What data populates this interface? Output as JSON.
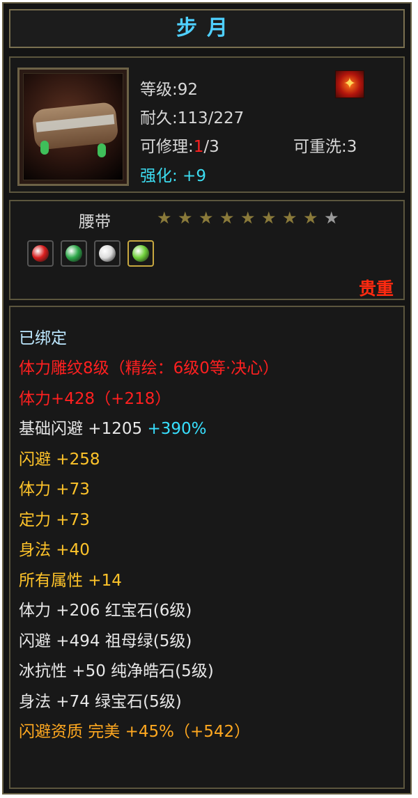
{
  "title": "步月",
  "item": {
    "level_label": "等级:92",
    "durability_label": "耐久:113/227",
    "repair_prefix": "可修理:",
    "repair_used": "1",
    "repair_total": "/3",
    "rewash_label": "可重洗:3",
    "enhance_label": "强化: +9",
    "type_label": "腰带",
    "rarity_label": "贵重",
    "stars_filled": 8,
    "stars_total": 9,
    "rune_glyph": "✦"
  },
  "gems": [
    {
      "name": "red-gem",
      "color": "#d81e1e"
    },
    {
      "name": "green-gem",
      "color": "#2ea84a"
    },
    {
      "name": "white-gem",
      "color": "#dcdcdc"
    },
    {
      "name": "emerald-gem",
      "color": "#6fcf3a"
    }
  ],
  "attributes": {
    "bound": "已绑定",
    "carving": "体力雕纹8级（精绘：6级0等·决心）",
    "stamina_bonus": "体力+428（+218）",
    "base_dodge_label": "基础闪避 +1205",
    "base_dodge_pct": "+390%",
    "dodge": "闪避 +258",
    "stamina": "体力 +73",
    "focus": "定力 +73",
    "agility": "身法 +40",
    "all_stats": "所有属性 +14",
    "gem_line_1": "体力 +206 红宝石(6级)",
    "gem_line_2": "闪避 +494 祖母绿(5级)",
    "gem_line_3": "冰抗性 +50 纯净皓石(5级)",
    "gem_line_4": "身法 +74 绿宝石(5级)",
    "aptitude": "闪避资质 完美 +45%（+542）"
  },
  "colors": {
    "title": "#4fd0ff",
    "rarity": "#ff2a10",
    "star_filled": "#8a7a3a",
    "star_empty": "#9a9a9a"
  }
}
